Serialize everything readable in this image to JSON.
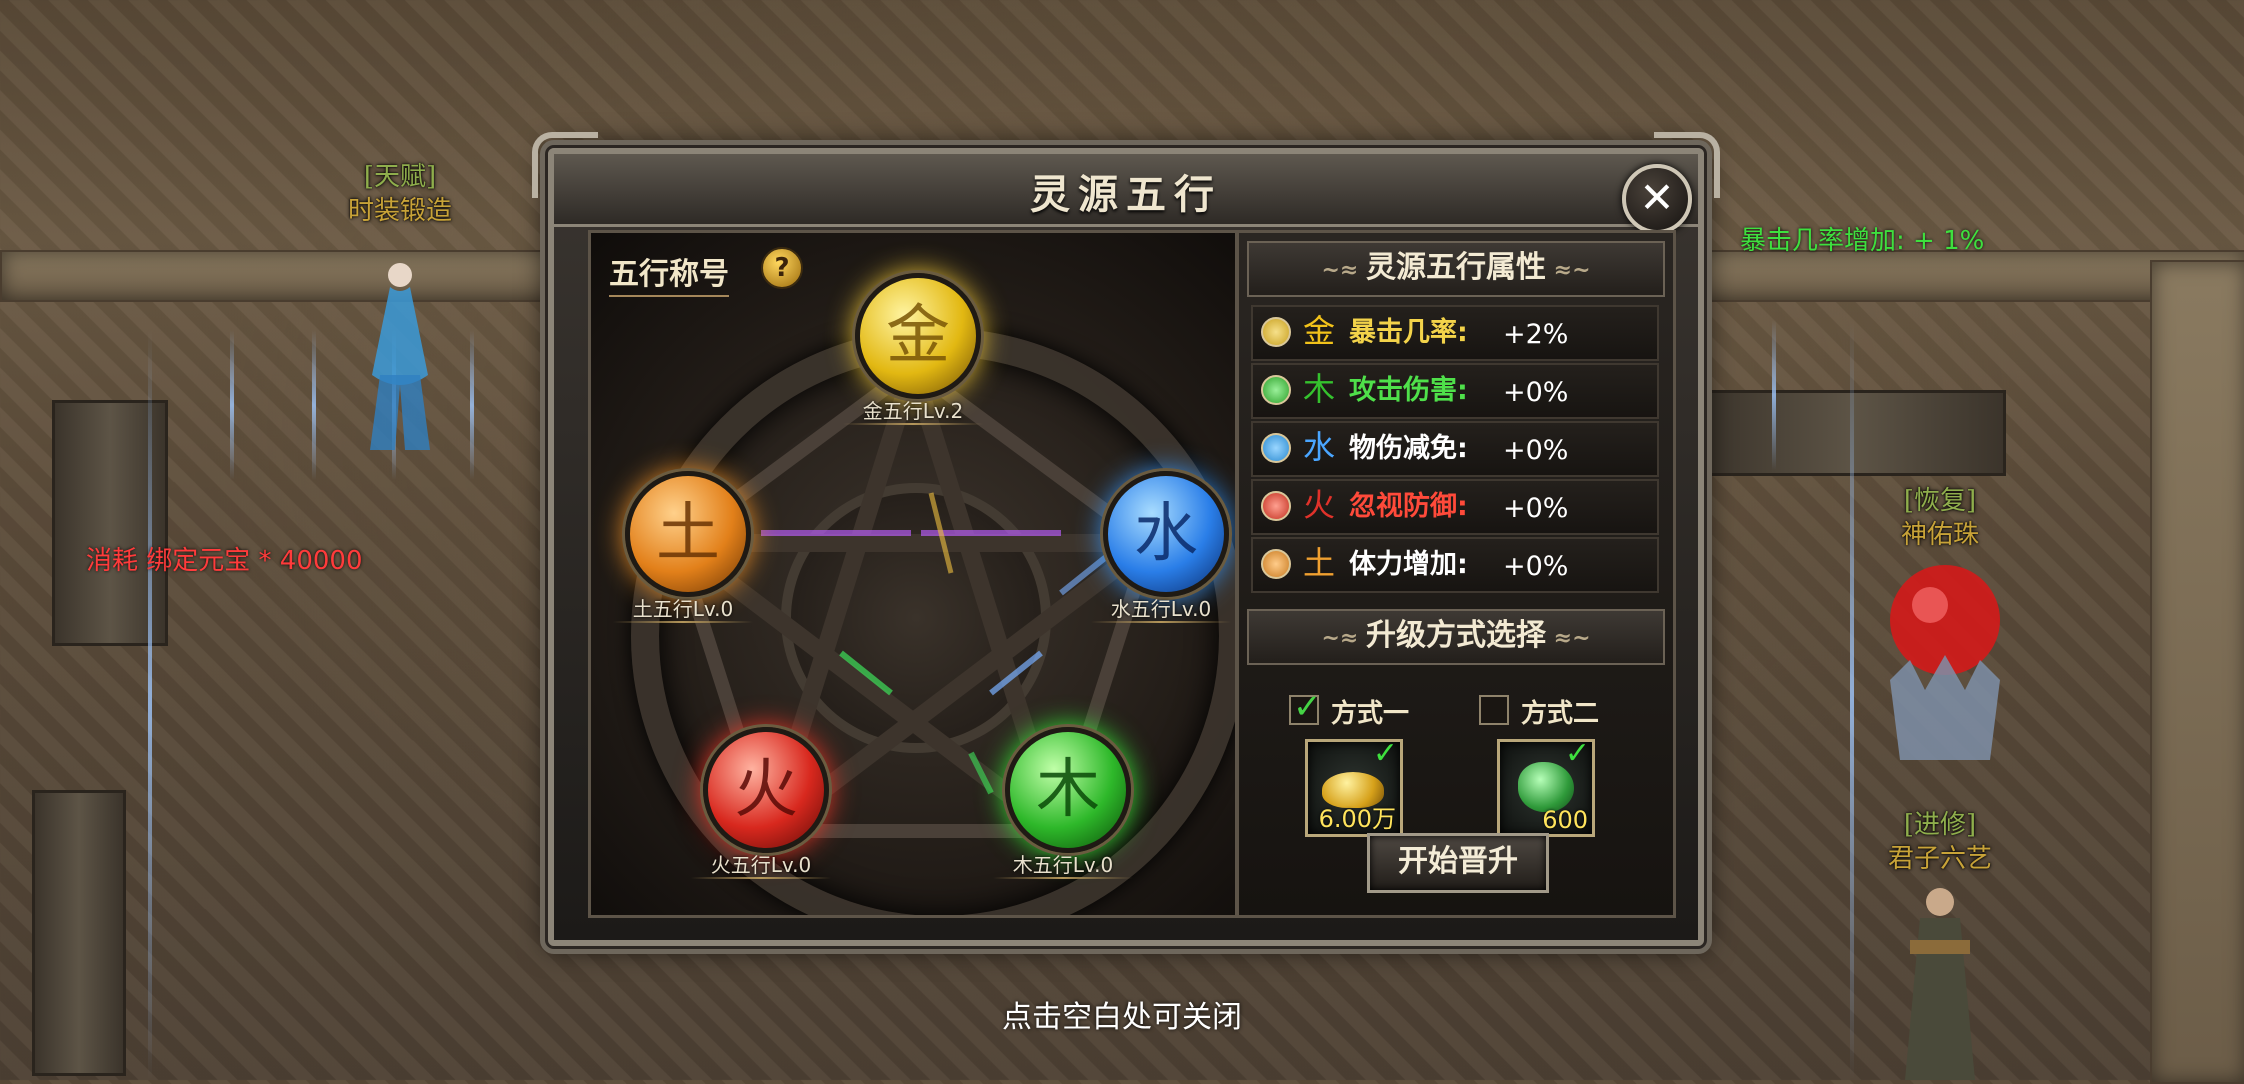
{
  "window": {
    "title": "灵源五行",
    "close_label": "✕"
  },
  "scene": {
    "npcs": [
      {
        "tag": "[天赋]",
        "name": "时装锻造"
      },
      {
        "tag": "[恢复]",
        "name": "神佑珠"
      },
      {
        "tag": "[进修]",
        "name": "君子六艺"
      }
    ],
    "cost_text": "消耗 绑定元宝 * 40000",
    "buff_text": "暴击几率增加: + 1%",
    "close_hint": "点击空白处可关闭"
  },
  "wuxing": {
    "section_title": "五行称号",
    "help_label": "?",
    "elements": [
      {
        "key": "metal",
        "glyph": "金",
        "label": "金五行Lv.2",
        "level": 2,
        "color": "#f2c21a"
      },
      {
        "key": "earth",
        "glyph": "土",
        "label": "土五行Lv.0",
        "level": 0,
        "color": "#f08a1c"
      },
      {
        "key": "water",
        "glyph": "水",
        "label": "水五行Lv.0",
        "level": 0,
        "color": "#2e86f0"
      },
      {
        "key": "fire",
        "glyph": "火",
        "label": "火五行Lv.0",
        "level": 0,
        "color": "#e0322a"
      },
      {
        "key": "wood",
        "glyph": "木",
        "label": "木五行Lv.0",
        "level": 0,
        "color": "#35c22e"
      }
    ]
  },
  "attributes": {
    "header": "灵源五行属性",
    "rows": [
      {
        "glyph": "金",
        "name": "暴击几率:",
        "value": "+2%",
        "name_color": "#f3d34a",
        "dot": "#c8a020"
      },
      {
        "glyph": "木",
        "name": "攻击伤害:",
        "value": "+0%",
        "name_color": "#4fe04a",
        "dot": "#2ea02a"
      },
      {
        "glyph": "水",
        "name": "物伤减免:",
        "value": "+0%",
        "name_color": "#ffffff",
        "dot": "#2a8ad0"
      },
      {
        "glyph": "火",
        "name": "忽视防御:",
        "value": "+0%",
        "name_color": "#ff4a3a",
        "dot": "#c23020"
      },
      {
        "glyph": "土",
        "name": "体力增加:",
        "value": "+0%",
        "name_color": "#ffffff",
        "dot": "#c87a20"
      }
    ]
  },
  "upgrade": {
    "header": "升级方式选择",
    "method1": {
      "label": "方式一",
      "checked": true,
      "item": "gold-ingot",
      "amount": "6.00万"
    },
    "method2": {
      "label": "方式二",
      "checked": false,
      "item": "jade-token",
      "amount": "600"
    },
    "start_label": "开始晋升"
  }
}
